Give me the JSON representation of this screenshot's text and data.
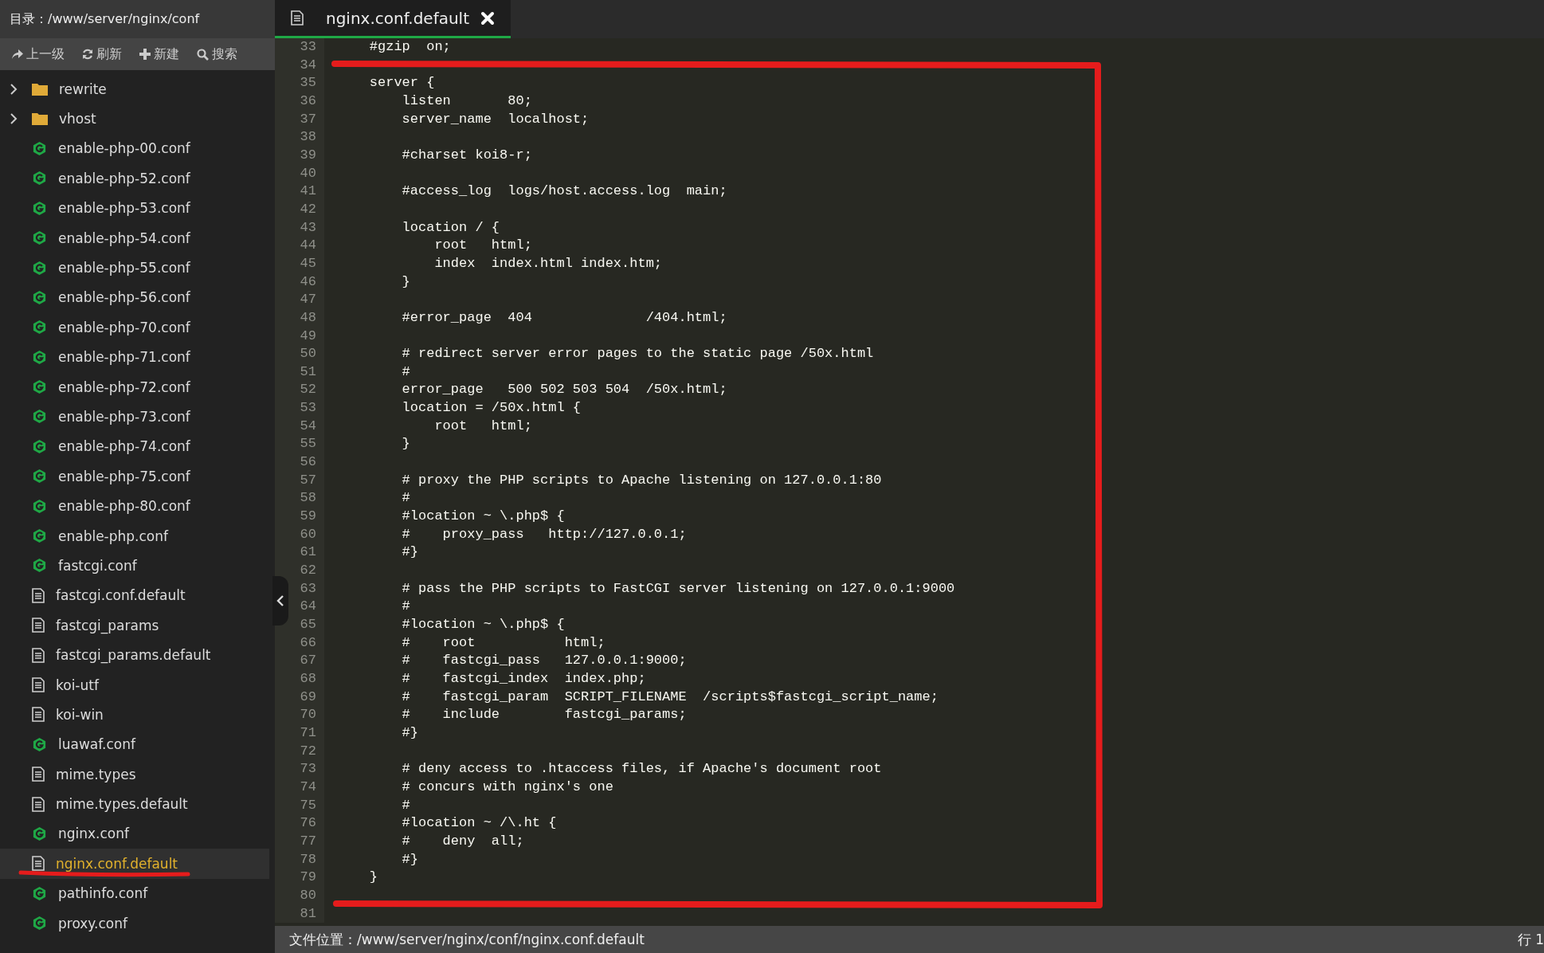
{
  "sidebar": {
    "path_label": "目录：/www/server/nginx/conf",
    "toolbar": [
      {
        "label": "上一级"
      },
      {
        "label": "刷新"
      },
      {
        "label": "新建"
      },
      {
        "label": "搜索"
      }
    ],
    "tree": [
      {
        "name": "rewrite",
        "kind": "folder",
        "selected": false
      },
      {
        "name": "vhost",
        "kind": "folder",
        "selected": false
      },
      {
        "name": "enable-php-00.conf",
        "kind": "conf",
        "selected": false
      },
      {
        "name": "enable-php-52.conf",
        "kind": "conf",
        "selected": false
      },
      {
        "name": "enable-php-53.conf",
        "kind": "conf",
        "selected": false
      },
      {
        "name": "enable-php-54.conf",
        "kind": "conf",
        "selected": false
      },
      {
        "name": "enable-php-55.conf",
        "kind": "conf",
        "selected": false
      },
      {
        "name": "enable-php-56.conf",
        "kind": "conf",
        "selected": false
      },
      {
        "name": "enable-php-70.conf",
        "kind": "conf",
        "selected": false
      },
      {
        "name": "enable-php-71.conf",
        "kind": "conf",
        "selected": false
      },
      {
        "name": "enable-php-72.conf",
        "kind": "conf",
        "selected": false
      },
      {
        "name": "enable-php-73.conf",
        "kind": "conf",
        "selected": false
      },
      {
        "name": "enable-php-74.conf",
        "kind": "conf",
        "selected": false
      },
      {
        "name": "enable-php-75.conf",
        "kind": "conf",
        "selected": false
      },
      {
        "name": "enable-php-80.conf",
        "kind": "conf",
        "selected": false
      },
      {
        "name": "enable-php.conf",
        "kind": "conf",
        "selected": false
      },
      {
        "name": "fastcgi.conf",
        "kind": "conf",
        "selected": false
      },
      {
        "name": "fastcgi.conf.default",
        "kind": "file",
        "selected": false
      },
      {
        "name": "fastcgi_params",
        "kind": "file",
        "selected": false
      },
      {
        "name": "fastcgi_params.default",
        "kind": "file",
        "selected": false
      },
      {
        "name": "koi-utf",
        "kind": "file",
        "selected": false
      },
      {
        "name": "koi-win",
        "kind": "file",
        "selected": false
      },
      {
        "name": "luawaf.conf",
        "kind": "conf",
        "selected": false
      },
      {
        "name": "mime.types",
        "kind": "file",
        "selected": false
      },
      {
        "name": "mime.types.default",
        "kind": "file",
        "selected": false
      },
      {
        "name": "nginx.conf",
        "kind": "conf",
        "selected": false
      },
      {
        "name": "nginx.conf.default",
        "kind": "file",
        "selected": true
      },
      {
        "name": "pathinfo.conf",
        "kind": "conf",
        "selected": false
      },
      {
        "name": "proxy.conf",
        "kind": "conf",
        "selected": false
      }
    ]
  },
  "editor": {
    "tabs": [
      {
        "title": "nginx.conf.default",
        "selected": true
      }
    ],
    "lines": [
      {
        "number": "33",
        "text": "    #gzip  on;"
      },
      {
        "number": "34"
      },
      {
        "number": "35",
        "text": "    server {"
      },
      {
        "number": "36",
        "text": "        listen       80;"
      },
      {
        "number": "37",
        "text": "        server_name  localhost;"
      },
      {
        "number": "38"
      },
      {
        "number": "39",
        "text": "        #charset koi8-r;"
      },
      {
        "number": "40"
      },
      {
        "number": "41",
        "text": "        #access_log  logs/host.access.log  main;"
      },
      {
        "number": "42"
      },
      {
        "number": "43",
        "text": "        location / {"
      },
      {
        "number": "44",
        "text": "            root   html;"
      },
      {
        "number": "45",
        "text": "            index  index.html index.htm;"
      },
      {
        "number": "46",
        "text": "        }"
      },
      {
        "number": "47"
      },
      {
        "number": "48",
        "text": "        #error_page  404              /404.html;"
      },
      {
        "number": "49"
      },
      {
        "number": "50",
        "text": "        # redirect server error pages to the static page /50x.html"
      },
      {
        "number": "51",
        "text": "        #"
      },
      {
        "number": "52",
        "text": "        error_page   500 502 503 504  /50x.html;"
      },
      {
        "number": "53",
        "text": "        location = /50x.html {"
      },
      {
        "number": "54",
        "text": "            root   html;"
      },
      {
        "number": "55",
        "text": "        }"
      },
      {
        "number": "56"
      },
      {
        "number": "57",
        "text": "        # proxy the PHP scripts to Apache listening on 127.0.0.1:80"
      },
      {
        "number": "58",
        "text": "        #"
      },
      {
        "number": "59",
        "text": "        #location ~ \\.php$ {"
      },
      {
        "number": "60",
        "text": "        #    proxy_pass   http://127.0.0.1;"
      },
      {
        "number": "61",
        "text": "        #}"
      },
      {
        "number": "62"
      },
      {
        "number": "63",
        "text": "        # pass the PHP scripts to FastCGI server listening on 127.0.0.1:9000"
      },
      {
        "number": "64",
        "text": "        #"
      },
      {
        "number": "65",
        "text": "        #location ~ \\.php$ {"
      },
      {
        "number": "66",
        "text": "        #    root           html;"
      },
      {
        "number": "67",
        "text": "        #    fastcgi_pass   127.0.0.1:9000;"
      },
      {
        "number": "68",
        "text": "        #    fastcgi_index  index.php;"
      },
      {
        "number": "69",
        "text": "        #    fastcgi_param  SCRIPT_FILENAME  /scripts$fastcgi_script_name;"
      },
      {
        "number": "70",
        "text": "        #    include        fastcgi_params;"
      },
      {
        "number": "71",
        "text": "        #}"
      },
      {
        "number": "72"
      },
      {
        "number": "73",
        "text": "        # deny access to .htaccess files, if Apache's document root"
      },
      {
        "number": "74",
        "text": "        # concurs with nginx's one"
      },
      {
        "number": "75",
        "text": "        #"
      },
      {
        "number": "76",
        "text": "        #location ~ /\\.ht {"
      },
      {
        "number": "77",
        "text": "        #    deny  all;"
      },
      {
        "number": "78",
        "text": "        #}"
      },
      {
        "number": "79",
        "text": "    }"
      },
      {
        "number": "80"
      },
      {
        "number": "81"
      }
    ]
  },
  "status_bar": {
    "file_location": "文件位置：/www/server/nginx/conf/nginx.conf.default",
    "cursor": "行 1"
  }
}
